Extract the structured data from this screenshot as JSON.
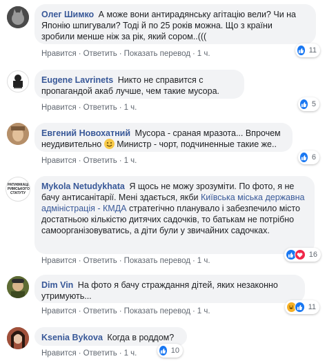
{
  "actions": {
    "like": "Нравится",
    "reply": "Ответить",
    "translate": "Показать перевод",
    "dot": "·"
  },
  "comments": [
    {
      "author": "Олег Шимко",
      "text": "А може вони антирадянську агітацію вели? Чи на Японію шпигували? Тоді й по 25 років можна. Що з країни зробили менше ніж за рік, який сором..(((",
      "time": "1 ч.",
      "reactions": "11",
      "show_translate": true
    },
    {
      "author": "Eugene Lavrinets",
      "text": "Никто не справится с пропагандой акаб лучше, чем такие мусора.",
      "time": "1 ч.",
      "reactions": "5",
      "show_translate": false
    },
    {
      "author": "Евгений Новохатний",
      "text_a": "Мусора - сраная мразота... Впрочем неудивительно",
      "text_b": "Министр - чорт, подчиненные такие же..",
      "time": "1 ч.",
      "reactions": "6",
      "show_translate": false
    },
    {
      "author": "Mykola Netudykhata",
      "text_a": "Я щось не можу зрозуміти. По фото, я не бачу антисанітарії. Мені здається, якби",
      "link": "Київська міська державна адміністрація - КМДА",
      "text_b": "стратегічно планувало і забезпечило місто достатньою кількістю дитячих садочків, то батькам не потрібно самоорганізовуватись, а діти були у звичайних садочках.",
      "time": "1 ч.",
      "reactions": "16",
      "show_translate": true,
      "avatar_text": "РАТИФІКАЦІЯ РИМСЬКОГО СТАТУТУ"
    },
    {
      "author": "Dim Vin",
      "text": "На фото я бачу страждання дітей, яких незаконно утримують...",
      "time": "1 ч.",
      "reactions": "11",
      "show_translate": true
    },
    {
      "author": "Ksenia Bykova",
      "text": "Когда в роддом?",
      "time": "1 ч.",
      "reactions": "10",
      "show_translate": false
    }
  ],
  "colors": {
    "link": "#385898",
    "bubble": "#f2f3f5",
    "like": "#1877f2",
    "love": "#f0284a",
    "haha": "#f7b125"
  }
}
